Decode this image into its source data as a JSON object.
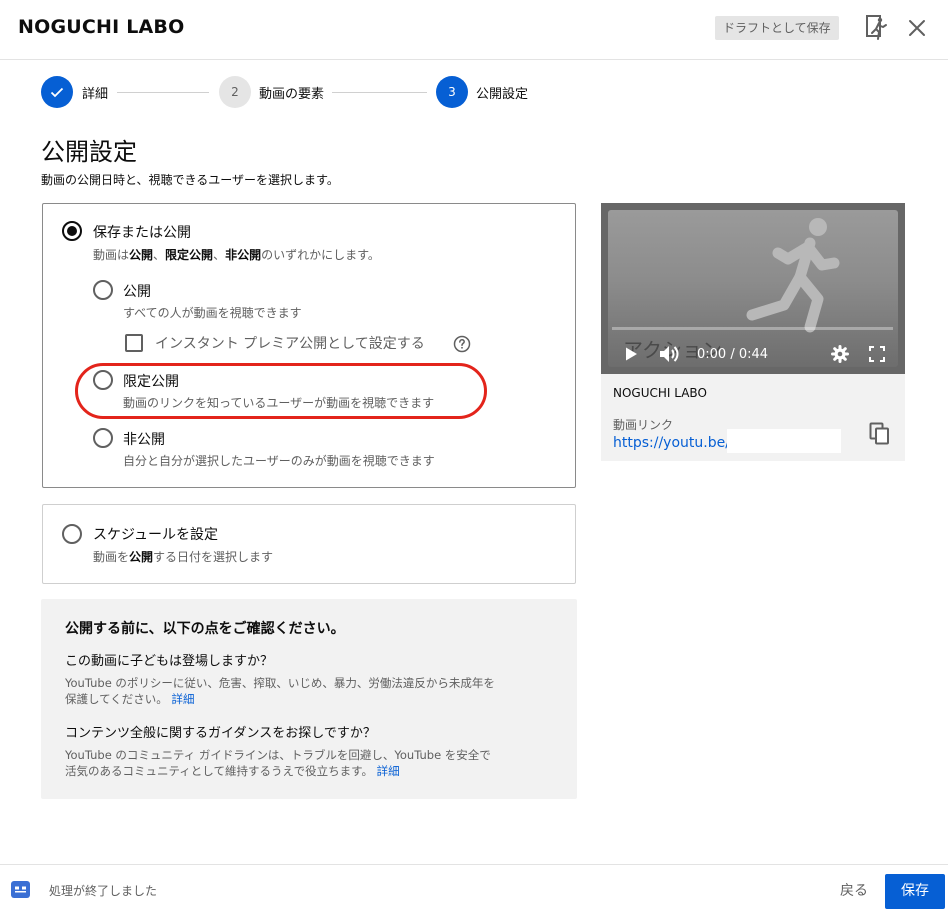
{
  "header": {
    "channel_name": "NOGUCHI LABO",
    "draft_button": "ドラフトとして保存"
  },
  "stepper": {
    "steps": [
      {
        "number": "1",
        "label": "詳細",
        "state": "done"
      },
      {
        "number": "2",
        "label": "動画の要素",
        "state": "inactive"
      },
      {
        "number": "3",
        "label": "公開設定",
        "state": "active"
      }
    ]
  },
  "page": {
    "title": "公開設定",
    "subtitle": "動画の公開日時と、視聴できるユーザーを選択します。"
  },
  "save_publish": {
    "title": "保存または公開",
    "desc_parts": [
      "動画は",
      "公開",
      "、",
      "限定公開",
      "、",
      "非公開",
      "のいずれかにします。"
    ],
    "selected": true,
    "options": [
      {
        "title": "公開",
        "desc": "すべての人が動画を視聴できます"
      },
      {
        "title": "限定公開",
        "desc": "動画のリンクを知っているユーザーが動画を視聴できます"
      },
      {
        "title": "非公開",
        "desc": "自分と自分が選択したユーザーのみが動画を視聴できます"
      }
    ],
    "premiere_label": "インスタント プレミア公開として設定する"
  },
  "schedule": {
    "title": "スケジュールを設定",
    "desc_parts": [
      "動画を",
      "公開",
      "する日付を選択します"
    ]
  },
  "info": {
    "title": "公開する前に、以下の点をご確認ください。",
    "q1": "この動画に子どもは登場しますか？",
    "a1": "YouTube のポリシーに従い、危害、搾取、いじめ、暴力、労働法違反から未成年を保護してください。",
    "a1_link": "詳細",
    "q2": "コンテンツ全般に関するガイダンスをお探しですか？",
    "a2": "YouTube のコミュニティ ガイドラインは、トラブルを回避し、YouTube を安全で活気のあるコミュニティとして維持するうえで役立ちます。",
    "a2_link": "詳細"
  },
  "video": {
    "overlay_text": "アクション",
    "time": "0:00 / 0:44",
    "channel": "NOGUCHI LABO",
    "link_label": "動画リンク",
    "link": "https://youtu.be/"
  },
  "footer": {
    "status": "処理が終了しました",
    "back": "戻る",
    "save": "保存"
  },
  "colors": {
    "accent": "#065fd4",
    "highlight": "#e3241b",
    "secondary_text": "#606060"
  }
}
